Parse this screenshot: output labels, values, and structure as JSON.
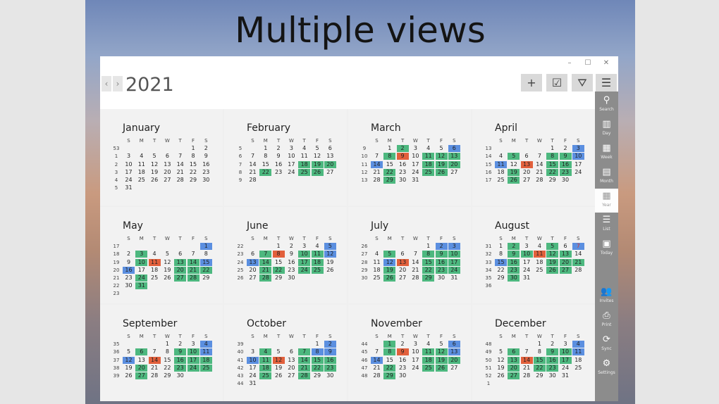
{
  "headline": "Multiple views",
  "window": {
    "minimize": "–",
    "maximize": "☐",
    "close": "✕"
  },
  "toolbar": {
    "prev": "‹",
    "next": "›",
    "year": "2021",
    "add": "+",
    "tasks": "☑",
    "filter": "⛛",
    "menu": "☰"
  },
  "sidebar": [
    {
      "icon": "search-icon",
      "glyph": "⚲",
      "label": "Search",
      "active": false,
      "pos": 0
    },
    {
      "icon": "day-icon",
      "glyph": "▥",
      "label": "Day",
      "active": false,
      "pos": 1
    },
    {
      "icon": "week-icon",
      "glyph": "▦",
      "label": "Week",
      "active": false,
      "pos": 2
    },
    {
      "icon": "month-icon",
      "glyph": "▤",
      "label": "Month",
      "active": false,
      "pos": 3
    },
    {
      "icon": "year-icon",
      "glyph": "▦",
      "label": "Year",
      "active": true,
      "pos": 4
    },
    {
      "icon": "list-icon",
      "glyph": "☰",
      "label": "List",
      "active": false,
      "pos": 5
    },
    {
      "icon": "today-icon",
      "glyph": "▣",
      "label": "Today",
      "active": false,
      "pos": 6
    },
    {
      "icon": "invites-icon",
      "glyph": "👥",
      "label": "Invites",
      "active": false,
      "pos": 8
    },
    {
      "icon": "print-icon",
      "glyph": "⎙",
      "label": "Print",
      "active": false,
      "pos": 9
    },
    {
      "icon": "sync-icon",
      "glyph": "⟳",
      "label": "Sync",
      "active": false,
      "pos": 10
    },
    {
      "icon": "settings-icon",
      "glyph": "⚙",
      "label": "Settings",
      "active": false,
      "pos": 11
    }
  ],
  "weekday_headers": [
    "S",
    "M",
    "T",
    "W",
    "T",
    "F",
    "S"
  ],
  "months": [
    {
      "name": "January",
      "first_weekday": 5,
      "days": 31,
      "week_numbers": [
        "53",
        "1",
        "2",
        "3",
        "4",
        "5"
      ],
      "green": [],
      "blue": [],
      "red": [],
      "red_text": []
    },
    {
      "name": "February",
      "first_weekday": 1,
      "days": 28,
      "week_numbers": [
        "5",
        "6",
        "7",
        "8",
        "9"
      ],
      "green": [
        18,
        19,
        20,
        22,
        25,
        26
      ],
      "blue": [],
      "red": [],
      "red_text": []
    },
    {
      "name": "March",
      "first_weekday": 1,
      "days": 31,
      "week_numbers": [
        "9",
        "10",
        "11",
        "12",
        "13"
      ],
      "green": [
        2,
        8,
        11,
        12,
        13,
        18,
        19,
        20,
        22,
        25,
        26,
        29
      ],
      "blue": [
        6,
        14
      ],
      "red": [
        9
      ],
      "red_text": []
    },
    {
      "name": "April",
      "first_weekday": 4,
      "days": 30,
      "week_numbers": [
        "13",
        "14",
        "15",
        "16",
        "17"
      ],
      "green": [
        5,
        8,
        9,
        10,
        15,
        16,
        19,
        22,
        23,
        26
      ],
      "blue": [
        3,
        10,
        11
      ],
      "red": [
        13
      ],
      "red_text": []
    },
    {
      "name": "May",
      "first_weekday": 6,
      "days": 31,
      "week_numbers": [
        "17",
        "18",
        "19",
        "20",
        "21",
        "22",
        "23"
      ],
      "green": [
        3,
        10,
        13,
        14,
        20,
        21,
        22,
        24,
        27,
        28,
        31
      ],
      "blue": [
        1,
        15,
        16
      ],
      "red": [
        11
      ],
      "red_text": []
    },
    {
      "name": "June",
      "first_weekday": 2,
      "days": 30,
      "week_numbers": [
        "22",
        "23",
        "24",
        "25",
        "26"
      ],
      "green": [
        7,
        10,
        11,
        14,
        17,
        18,
        21,
        22,
        24,
        25,
        28
      ],
      "blue": [
        5,
        12,
        13
      ],
      "red": [
        8
      ],
      "red_text": []
    },
    {
      "name": "July",
      "first_weekday": 4,
      "days": 31,
      "week_numbers": [
        "26",
        "27",
        "28",
        "29",
        "30"
      ],
      "green": [
        5,
        8,
        9,
        10,
        15,
        16,
        17,
        19,
        22,
        23,
        24,
        26,
        29
      ],
      "blue": [
        2,
        3,
        12
      ],
      "red": [
        13
      ],
      "red_text": []
    },
    {
      "name": "August",
      "first_weekday": 0,
      "days": 31,
      "week_numbers": [
        "31",
        "32",
        "33",
        "34",
        "35",
        "36"
      ],
      "green": [
        2,
        5,
        9,
        10,
        12,
        13,
        16,
        19,
        20,
        21,
        23,
        26,
        27,
        30
      ],
      "blue": [
        7,
        15
      ],
      "red": [
        11
      ],
      "red_text": [
        7
      ]
    },
    {
      "name": "September",
      "first_weekday": 3,
      "days": 30,
      "week_numbers": [
        "35",
        "36",
        "37",
        "38",
        "39"
      ],
      "green": [
        6,
        9,
        10,
        16,
        17,
        18,
        20,
        23,
        24,
        25,
        27
      ],
      "blue": [
        4,
        11,
        12
      ],
      "red": [
        14
      ],
      "red_text": []
    },
    {
      "name": "October",
      "first_weekday": 5,
      "days": 31,
      "week_numbers": [
        "39",
        "40",
        "41",
        "42",
        "43",
        "44"
      ],
      "green": [
        4,
        7,
        11,
        14,
        15,
        16,
        18,
        21,
        22,
        23,
        25,
        28
      ],
      "blue": [
        2,
        8,
        9,
        10
      ],
      "red": [
        12
      ],
      "red_text": []
    },
    {
      "name": "November",
      "first_weekday": 1,
      "days": 30,
      "week_numbers": [
        "44",
        "45",
        "46",
        "47",
        "48"
      ],
      "green": [
        1,
        8,
        11,
        12,
        18,
        19,
        20,
        22,
        25,
        26,
        29
      ],
      "blue": [
        6,
        13,
        14
      ],
      "red": [
        9
      ],
      "red_text": []
    },
    {
      "name": "December",
      "first_weekday": 3,
      "days": 31,
      "week_numbers": [
        "48",
        "49",
        "50",
        "51",
        "52",
        "1"
      ],
      "green": [
        6,
        9,
        10,
        13,
        15,
        16,
        17,
        20,
        22,
        23,
        27
      ],
      "blue": [
        4,
        11
      ],
      "red": [
        14
      ],
      "red_text": []
    }
  ]
}
